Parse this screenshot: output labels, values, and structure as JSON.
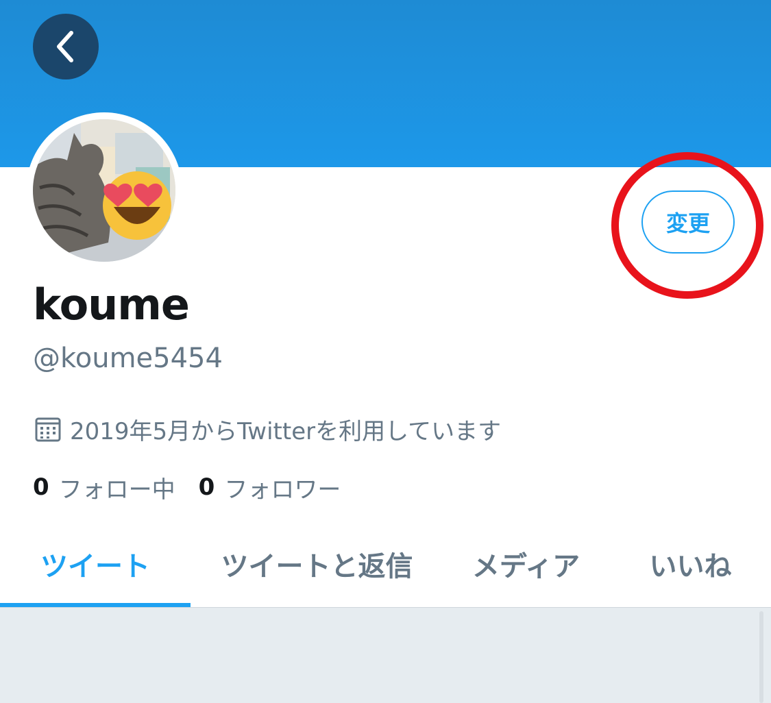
{
  "header": {
    "back_icon": "chevron-left-icon",
    "banner_color": "#1d98e9"
  },
  "profile": {
    "avatar_description_icon": "cat-with-heart-eyes-emoji",
    "display_name": "koume",
    "handle": "@koume5454",
    "joined_icon": "calendar-icon",
    "joined_text": "2019年5月からTwitterを利用しています",
    "following_count": "0",
    "following_label": "フォロー中",
    "followers_count": "0",
    "followers_label": "フォロワー",
    "change_button_label": "変更"
  },
  "tabs": [
    {
      "label": "ツイート",
      "active": true
    },
    {
      "label": "ツイートと返信",
      "active": false
    },
    {
      "label": "メディア",
      "active": false
    },
    {
      "label": "いいね",
      "active": false
    }
  ],
  "colors": {
    "accent": "#1da1f2",
    "highlight_ring": "#e8131b",
    "secondary_text": "#657786",
    "primary_text": "#14171a"
  }
}
